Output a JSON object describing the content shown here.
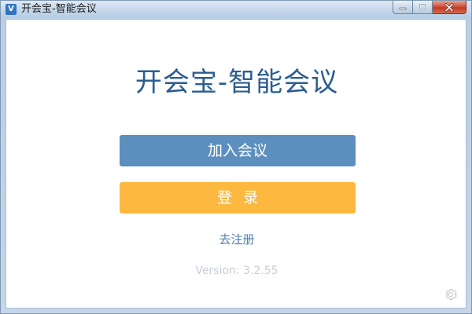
{
  "window": {
    "title": "开会宝-智能会议",
    "icon": "app-logo-icon",
    "icon_glyph": "V"
  },
  "main": {
    "app_title": "开会宝-智能会议",
    "join_button_label": "加入会议",
    "login_button_label": "登录",
    "register_link": "去注册",
    "version_text": "Version: 3.2.55",
    "settings_icon": "gear-icon"
  },
  "colors": {
    "title_text": "#2b5d92",
    "join_button": "#5d8fbe",
    "login_button": "#fdb93f",
    "link": "#4d7fae",
    "version_text": "#c9cfd7"
  }
}
